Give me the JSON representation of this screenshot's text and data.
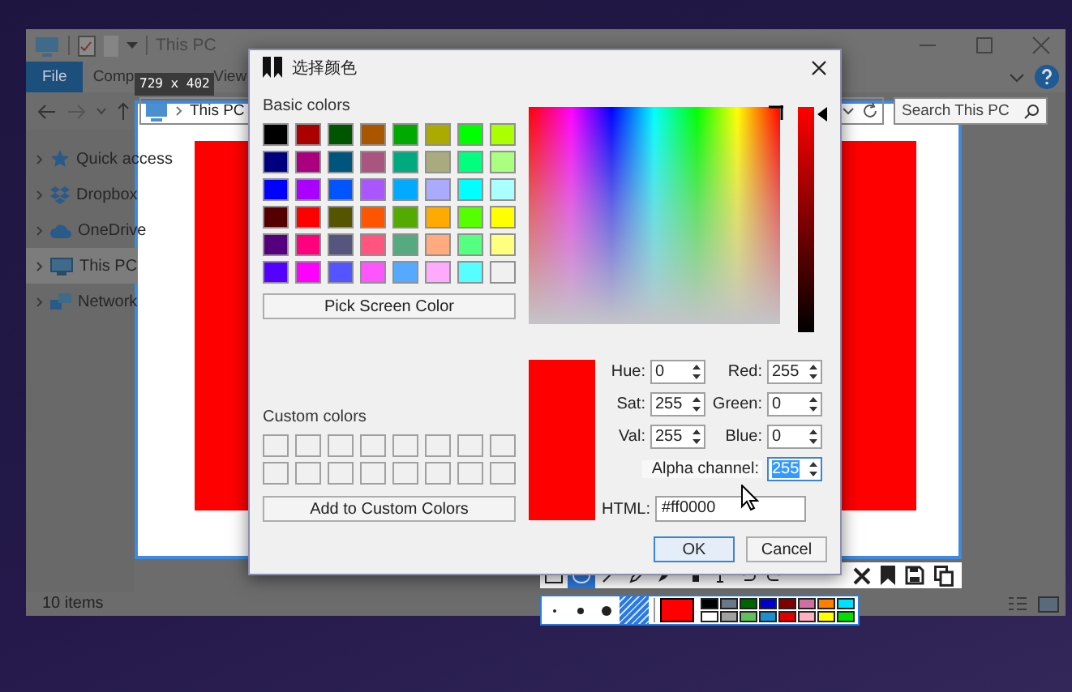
{
  "explorer": {
    "title": "This PC",
    "ribbon_tabs": [
      {
        "label": "File",
        "selected": true
      },
      {
        "label": "Comp",
        "selected": false
      },
      {
        "label": "View",
        "selected": false
      }
    ],
    "address": {
      "path": "This PC"
    },
    "search": {
      "placeholder": "Search This PC"
    },
    "nav_items": [
      {
        "label": "Quick access",
        "kind": "star",
        "selected": false
      },
      {
        "label": "Dropbox",
        "kind": "box",
        "selected": false
      },
      {
        "label": "OneDrive",
        "kind": "cloud",
        "selected": false
      },
      {
        "label": "This PC",
        "kind": "computer",
        "selected": true
      },
      {
        "label": "Network",
        "kind": "network",
        "selected": false
      }
    ],
    "status_bar": "10 items"
  },
  "selection": {
    "size": "729 x 402"
  },
  "dialog": {
    "title": "选择颜色",
    "basic_colors_label": "Basic colors",
    "basic_colors": [
      {
        "color": "#000000"
      },
      {
        "color": "#aa0000"
      },
      {
        "color": "#005500"
      },
      {
        "color": "#aa5500"
      },
      {
        "color": "#00aa00"
      },
      {
        "color": "#aaaa00"
      },
      {
        "color": "#00ff00"
      },
      {
        "color": "#aaff00"
      },
      {
        "color": "#00007f"
      },
      {
        "color": "#aa007f"
      },
      {
        "color": "#00557f"
      },
      {
        "color": "#aa557f"
      },
      {
        "color": "#00aa7f"
      },
      {
        "color": "#aaaa7f"
      },
      {
        "color": "#00ff7f"
      },
      {
        "color": "#aaff7f"
      },
      {
        "color": "#0000ff"
      },
      {
        "color": "#aa00ff"
      },
      {
        "color": "#0055ff"
      },
      {
        "color": "#aa55ff"
      },
      {
        "color": "#00aaff"
      },
      {
        "color": "#aaaaff"
      },
      {
        "color": "#00ffff"
      },
      {
        "color": "#aaffff"
      },
      {
        "color": "#550000"
      },
      {
        "color": "#ff0000"
      },
      {
        "color": "#555500"
      },
      {
        "color": "#ff5500"
      },
      {
        "color": "#55aa00"
      },
      {
        "color": "#ffaa00"
      },
      {
        "color": "#55ff00"
      },
      {
        "color": "#ffff00"
      },
      {
        "color": "#55007f"
      },
      {
        "color": "#ff007f"
      },
      {
        "color": "#55557f"
      },
      {
        "color": "#ff557f"
      },
      {
        "color": "#55aa7f"
      },
      {
        "color": "#ffaa7f"
      },
      {
        "color": "#55ff7f"
      },
      {
        "color": "#ffff7f"
      },
      {
        "color": "#5500ff"
      },
      {
        "color": "#ff00ff"
      },
      {
        "color": "#5555ff"
      },
      {
        "color": "#ff55ff"
      },
      {
        "color": "#55aaff"
      },
      {
        "color": "#ffaaff"
      },
      {
        "color": "#55ffff"
      },
      {
        "color": "#f0f0f0"
      }
    ],
    "pick_button": "Pick Screen Color",
    "custom_colors_label": "Custom colors",
    "add_button": "Add to Custom Colors",
    "value_slider": {
      "level": 1
    },
    "preview": {
      "color": "#ff0000"
    },
    "fields": [
      {
        "label": "Hue:",
        "value": "0",
        "selected": false
      },
      {
        "label": "Red:",
        "value": "255",
        "selected": false
      },
      {
        "label": "Sat:",
        "value": "255",
        "selected": false
      },
      {
        "label": "Green:",
        "value": "0",
        "selected": false
      },
      {
        "label": "Val:",
        "value": "255",
        "selected": false
      },
      {
        "label": "Blue:",
        "value": "0",
        "selected": false
      }
    ],
    "alpha": {
      "label": "Alpha channel:",
      "value": "255",
      "selected": true
    },
    "html": {
      "label": "HTML:",
      "value": "#ff0000"
    },
    "buttons": [
      {
        "label": "OK",
        "default": true
      },
      {
        "label": "Cancel",
        "default": false
      }
    ]
  },
  "toolbar": {
    "tools": [
      {
        "kind": "rectangle",
        "selected": false
      },
      {
        "kind": "ellipse",
        "selected": true
      },
      {
        "kind": "line",
        "selected": false
      },
      {
        "kind": "pen",
        "selected": false
      },
      {
        "kind": "marker",
        "selected": false
      },
      {
        "kind": "mosaic",
        "selected": false
      },
      {
        "kind": "text",
        "selected": false
      },
      {
        "kind": "undo",
        "selected": false
      },
      {
        "kind": "redo",
        "selected": false
      }
    ],
    "actions": [
      {
        "kind": "close"
      },
      {
        "kind": "pin"
      },
      {
        "kind": "save"
      },
      {
        "kind": "copy"
      }
    ]
  },
  "pen_bar": {
    "sizes": [
      {
        "kind": "small",
        "selected": false
      },
      {
        "kind": "medium",
        "selected": false
      },
      {
        "kind": "large",
        "selected": false
      }
    ],
    "fill": {
      "selected": true
    },
    "current_color": {
      "color": "#ff0000"
    },
    "palette": [
      {
        "color": "#000000"
      },
      {
        "color": "#6b7888"
      },
      {
        "color": "#006400"
      },
      {
        "color": "#0000cc"
      },
      {
        "color": "#800000"
      },
      {
        "color": "#d070a0"
      },
      {
        "color": "#ff8000"
      },
      {
        "color": "#00e0ff"
      },
      {
        "color": "#ffffff"
      },
      {
        "color": "#a0a0a0"
      },
      {
        "color": "#60c060"
      },
      {
        "color": "#1a90d0"
      },
      {
        "color": "#e00000"
      },
      {
        "color": "#ffb0c0"
      },
      {
        "color": "#ffff00"
      },
      {
        "color": "#00e000"
      }
    ]
  }
}
